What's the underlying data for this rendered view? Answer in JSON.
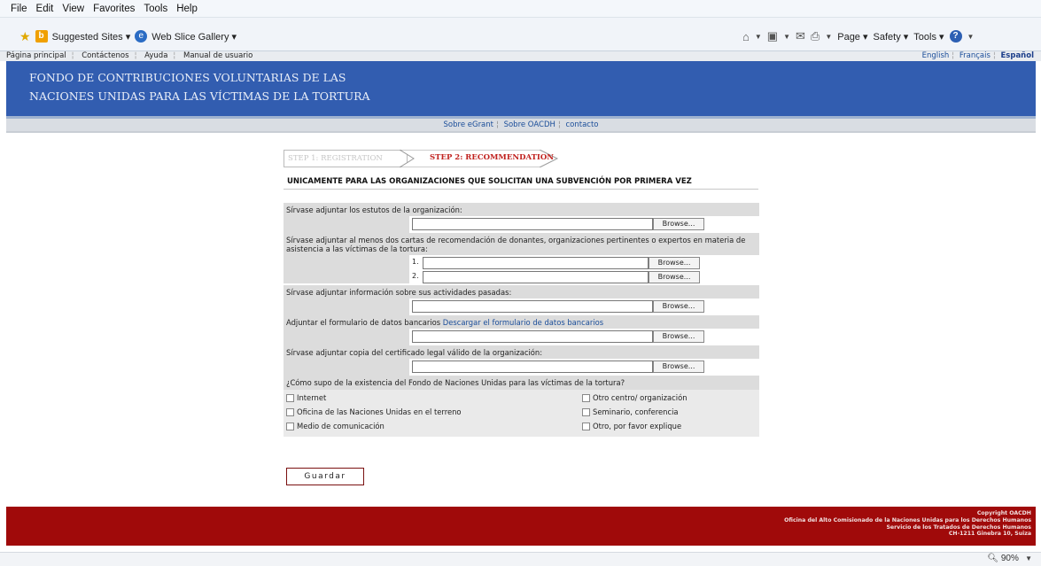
{
  "browser": {
    "menu": [
      "File",
      "Edit",
      "View",
      "Favorites",
      "Tools",
      "Help"
    ],
    "favorites": {
      "suggested_sites": "Suggested Sites ▾",
      "web_slice": "Web Slice Gallery ▾"
    },
    "command": {
      "page": "Page ▾",
      "safety": "Safety ▾",
      "tools": "Tools ▾"
    },
    "zoom": "90%"
  },
  "topnav": {
    "home": "Página principal",
    "contact": "Contáctenos",
    "help": "Ayuda",
    "manual": "Manual de usuario",
    "english": "English",
    "french": "Français",
    "spanish": "Español"
  },
  "banner": {
    "line1": "FONDO DE CONTRIBUCIONES VOLUNTARIAS DE LAS",
    "line2": "NACIONES UNIDAS PARA LAS VÍCTIMAS DE LA TORTURA"
  },
  "links": {
    "egrant": "Sobre eGrant",
    "oacdh": "Sobre OACDH",
    "contacto": "contacto"
  },
  "steps": {
    "step1": "STEP 1: REGISTRATION",
    "step2": "STEP 2: RECOMMENDATION"
  },
  "heading": "UNICAMENTE PARA LAS ORGANIZACIONES QUE SOLICITAN UNA SUBVENCIÓN POR PRIMERA VEZ",
  "form": {
    "browse_label": "Browse...",
    "statutes_label": "Sírvase adjuntar los estutos de la organización:",
    "letters_label": "Sírvase adjuntar al menos dos cartas de recomendación de donantes, organizaciones pertinentes o expertos en materia de asistencia a las víctimas de la tortura:",
    "letter1_num": "1.",
    "letter2_num": "2.",
    "activities_label": "Sírvase adjuntar información sobre sus actividades pasadas:",
    "bank_label": "Adjuntar el formulario de datos bancarios",
    "bank_link": "Descargar el formulario de datos bancarios",
    "certificate_label": "Sírvase adjuntar copia del certificado legal válido de la organización:",
    "question": "¿Cómo supo de la existencia del Fondo de Naciones Unidas para las víctimas de la tortura?",
    "options": {
      "internet": "Internet",
      "un_office": "Oficina de las Naciones Unidas en el terreno",
      "media": "Medio de comunicación",
      "other_center": "Otro centro/ organización",
      "seminar": "Seminario, conferencia",
      "other": "Otro, por favor explique"
    },
    "save_label": "Guardar"
  },
  "footer": {
    "copyright": "Copyright OACDH",
    "line1": "Oficina del Alto Comisionado de la Naciones Unidas para los Derechos Humanos",
    "line2": "Servicio de los Tratados de Derechos Humanos",
    "line3": "CH-1211 Ginebra 10, Suiza"
  }
}
